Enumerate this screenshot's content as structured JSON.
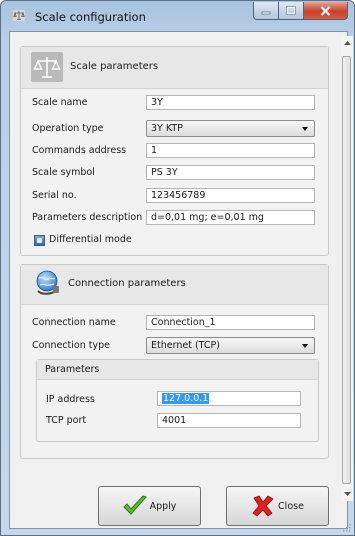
{
  "window": {
    "title": "Scale configuration",
    "controls": [
      "minimize-icon",
      "maximize-icon",
      "close-icon"
    ]
  },
  "scale_parameters": {
    "title": "Scale parameters",
    "icon": "scales-icon",
    "fields": {
      "scale_name": {
        "label": "Scale name",
        "value": "3Y"
      },
      "operation_type": {
        "label": "Operation type",
        "value": "3Y KTP"
      },
      "commands_address": {
        "label": "Commands address",
        "value": "1"
      },
      "scale_symbol": {
        "label": "Scale symbol",
        "value": "PS 3Y"
      },
      "serial_no": {
        "label": "Serial no.",
        "value": "123456789"
      },
      "parameters_description": {
        "label": "Parameters description",
        "value": "d=0,01 mg; e=0,01 mg"
      }
    },
    "differential_mode": {
      "label": "Differential mode",
      "checked": true
    }
  },
  "connection_parameters": {
    "title": "Connection parameters",
    "icon": "globe-connection-icon",
    "connection_name": {
      "label": "Connection name",
      "value": "Connection_1"
    },
    "connection_type": {
      "label": "Connection type",
      "value": "Ethernet (TCP)"
    },
    "parameters": {
      "title": "Parameters",
      "ip_address": {
        "label": "IP address",
        "value": "127.0.0.1"
      },
      "tcp_port": {
        "label": "TCP port",
        "value": "4001"
      }
    }
  },
  "buttons": {
    "apply": {
      "label": "Apply",
      "icon": "green-check-icon"
    },
    "close": {
      "label": "Close",
      "icon": "red-x-icon"
    }
  },
  "colors": {
    "titlebar": "#b8cfe6",
    "panel_bg": "#f2f2f2",
    "selection": "#3399ff",
    "close_button": "#c6412a"
  }
}
